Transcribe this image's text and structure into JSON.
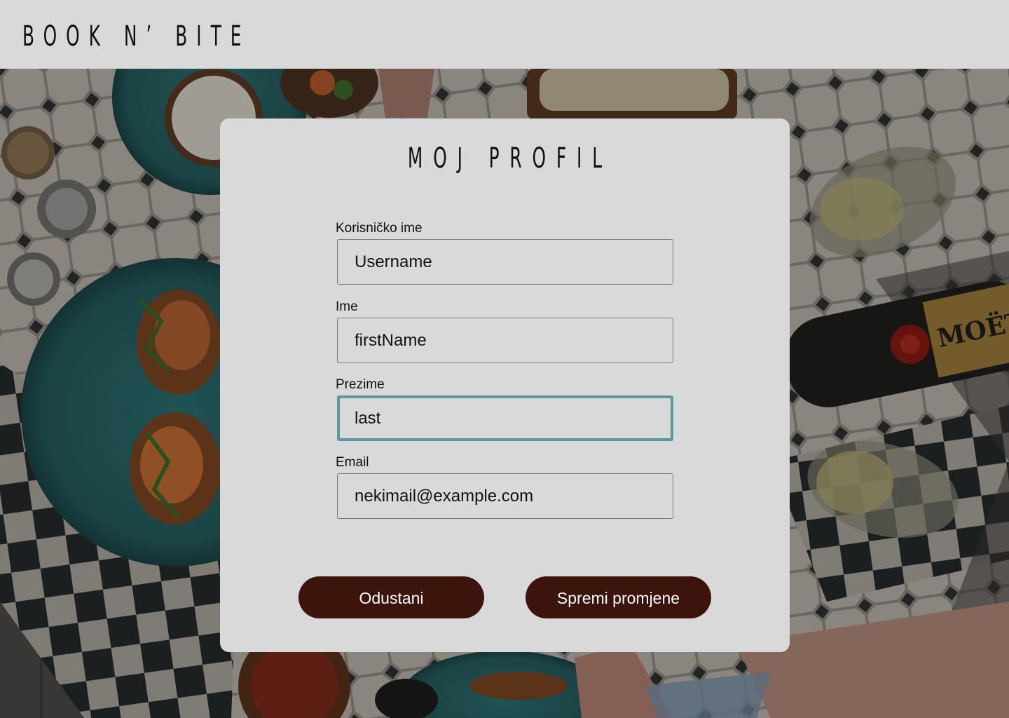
{
  "header": {
    "logo": "BOOK N’ BITE"
  },
  "profile": {
    "title": "MOJ PROFIL",
    "fields": [
      {
        "label": "Korisničko ime",
        "value": "Username"
      },
      {
        "label": "Ime",
        "value": "firstName"
      },
      {
        "label": "Prezime",
        "value": "last"
      },
      {
        "label": "Email",
        "value": "nekimail@example.com"
      }
    ],
    "cancel_label": "Odustani",
    "save_label": "Spremi promjene"
  },
  "background": {
    "bottle_label": "MOËT"
  },
  "colors": {
    "header_bg": "#d9d9d9",
    "card_bg": "#d9d9d9",
    "button_bg": "#3c140c",
    "focus_border": "#5a98a0"
  }
}
